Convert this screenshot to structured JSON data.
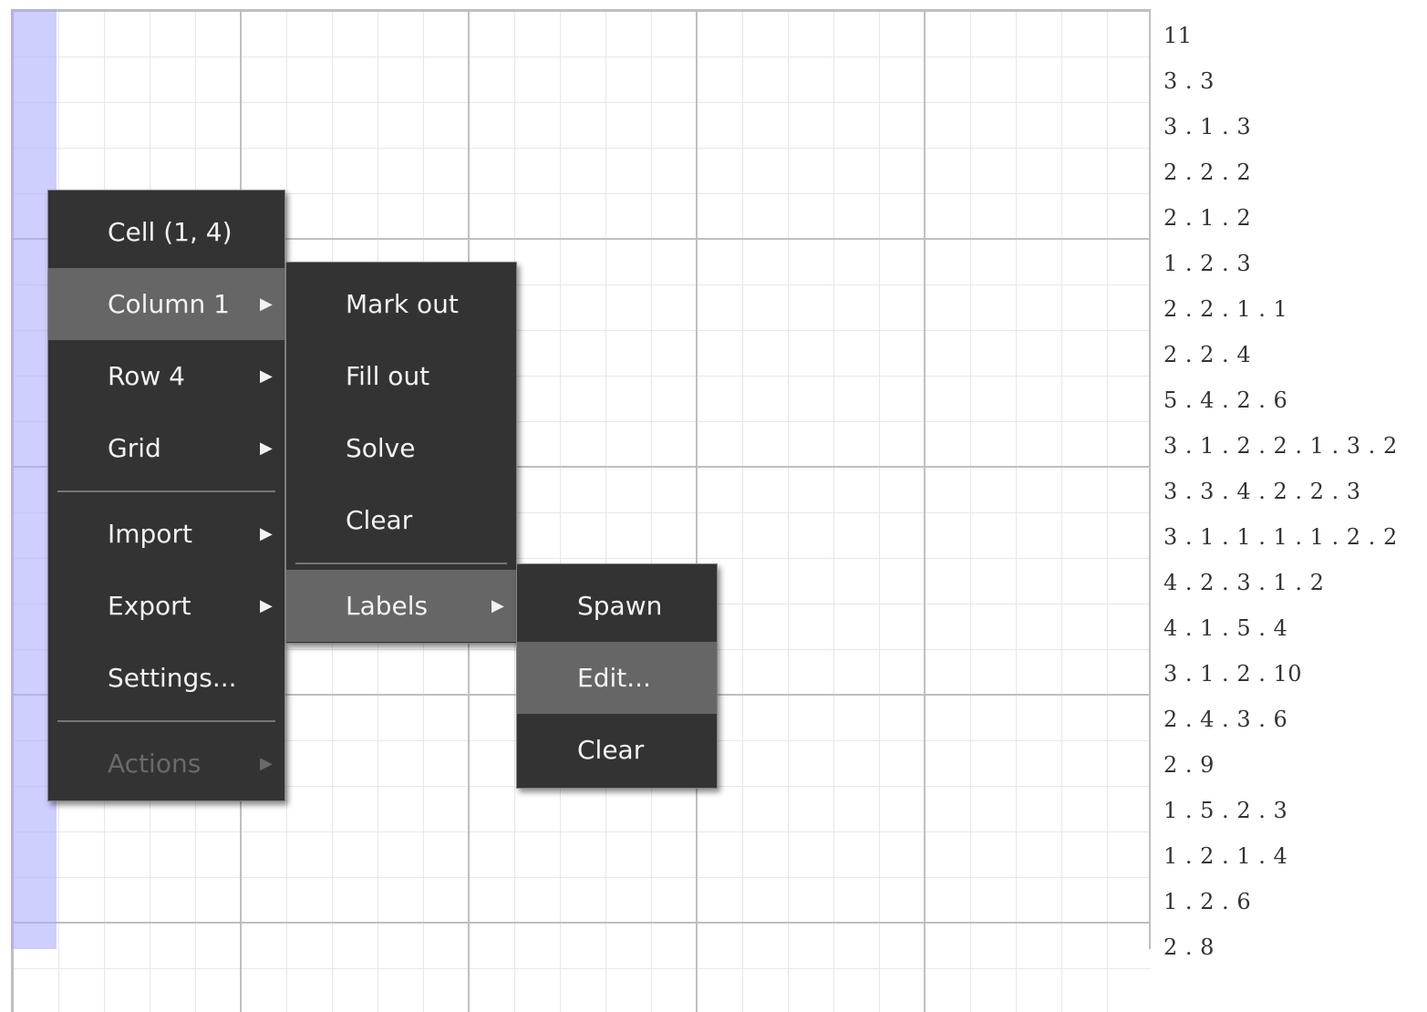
{
  "grid": {
    "row_clues": [
      "11",
      "3 . 3",
      "3 . 1 . 3",
      "2 . 2 . 2",
      "2 . 1 . 2",
      "1 . 2 . 3",
      "2 . 2 . 1 . 1",
      "2 . 2 . 4",
      "5 . 4 . 2 . 6",
      "3 . 1 . 2 . 2 . 1 . 3 . 2",
      "3 . 3 . 4 . 2 . 2 . 3",
      "3 . 1 . 1 . 1 . 1 . 2 . 2",
      "4 . 2 . 3 . 1 . 2",
      "4 . 1 . 5 . 4",
      "3 . 1 . 2 . 10",
      "2 . 4 . 3 . 6",
      "2 . 9",
      "1 . 5 . 2 . 3",
      "1 . 2 . 1 . 4",
      "1 . 2 . 6",
      "2 . 8"
    ]
  },
  "context_menu": {
    "cell": "Cell (1, 4)",
    "column": "Column 1",
    "row": "Row 4",
    "grid": "Grid",
    "import": "Import",
    "export": "Export",
    "settings": "Settings...",
    "actions": "Actions",
    "arrow": "▶"
  },
  "column_submenu": {
    "mark_out": "Mark out",
    "fill_out": "Fill out",
    "solve": "Solve",
    "clear": "Clear",
    "labels": "Labels",
    "arrow": "▶"
  },
  "labels_submenu": {
    "spawn": "Spawn",
    "edit": "Edit...",
    "clear": "Clear"
  }
}
